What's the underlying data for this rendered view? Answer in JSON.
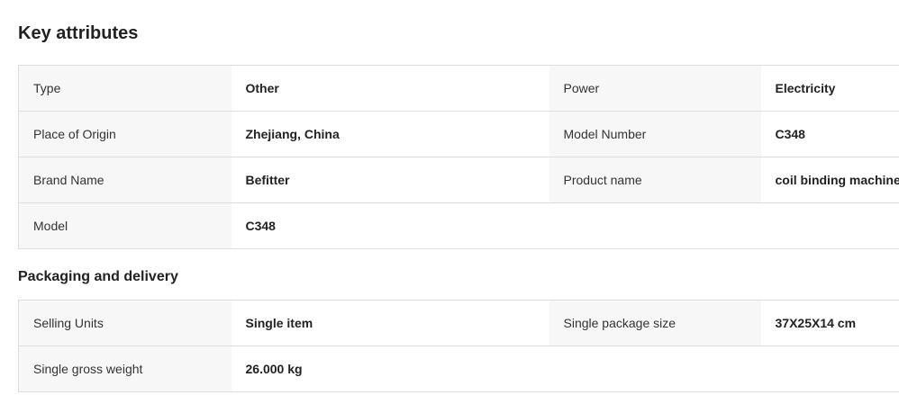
{
  "key_attributes": {
    "title": "Key attributes",
    "rows": [
      [
        {
          "label": "Type",
          "value": "Other"
        },
        {
          "label": "Power",
          "value": "Electricity"
        }
      ],
      [
        {
          "label": "Place of Origin",
          "value": "Zhejiang, China"
        },
        {
          "label": "Model Number",
          "value": "C348"
        }
      ],
      [
        {
          "label": "Brand Name",
          "value": "Befitter"
        },
        {
          "label": "Product name",
          "value": "coil binding machine"
        }
      ],
      [
        {
          "label": "Model",
          "value": "C348"
        }
      ]
    ]
  },
  "packaging": {
    "title": "Packaging and delivery",
    "rows": [
      [
        {
          "label": "Selling Units",
          "value": "Single item"
        },
        {
          "label": "Single package size",
          "value": "37X25X14 cm"
        }
      ],
      [
        {
          "label": "Single gross weight",
          "value": "26.000 kg"
        }
      ]
    ]
  }
}
